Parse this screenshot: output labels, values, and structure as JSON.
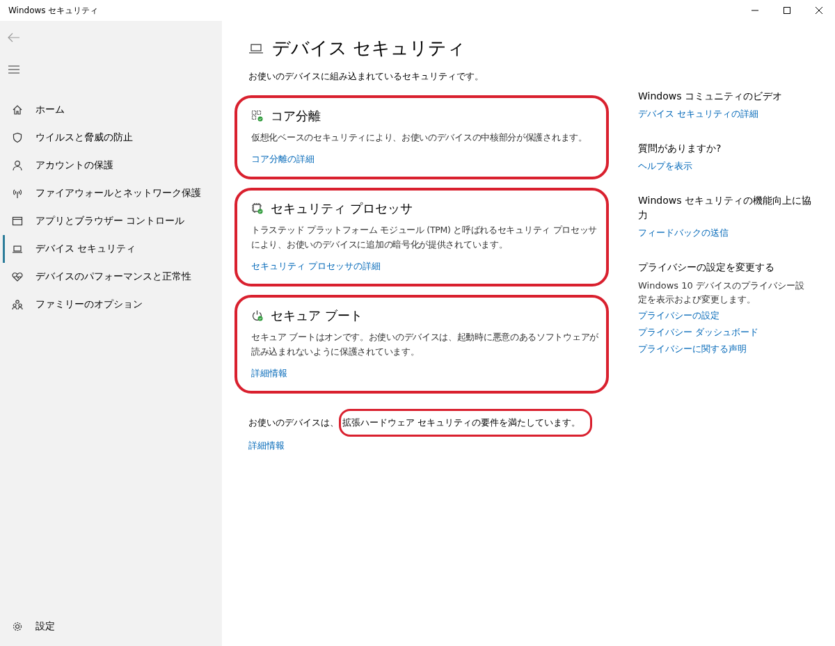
{
  "window": {
    "title": "Windows セキュリティ"
  },
  "sidebar": {
    "items": [
      {
        "label": "ホーム",
        "selected": false
      },
      {
        "label": "ウイルスと脅威の防止",
        "selected": false
      },
      {
        "label": "アカウントの保護",
        "selected": false
      },
      {
        "label": "ファイアウォールとネットワーク保護",
        "selected": false
      },
      {
        "label": "アプリとブラウザー コントロール",
        "selected": false
      },
      {
        "label": "デバイス セキュリティ",
        "selected": true
      },
      {
        "label": "デバイスのパフォーマンスと正常性",
        "selected": false
      },
      {
        "label": "ファミリーのオプション",
        "selected": false
      }
    ],
    "settings": "設定"
  },
  "page": {
    "title": "デバイス セキュリティ",
    "subtitle": "お使いのデバイスに組み込まれているセキュリティです。",
    "sections": [
      {
        "title": "コア分離",
        "text": "仮想化ベースのセキュリティにより、お使いのデバイスの中核部分が保護されます。",
        "link": "コア分離の詳細",
        "circled": true
      },
      {
        "title": "セキュリティ プロセッサ",
        "text": "トラステッド プラットフォーム モジュール (TPM) と呼ばれるセキュリティ プロセッサにより、お使いのデバイスに追加の暗号化が提供されています。",
        "link": "セキュリティ プロセッサの詳細",
        "circled": true
      },
      {
        "title": "セキュア ブート",
        "text": "セキュア ブートはオンです。お使いのデバイスは、起動時に悪意のあるソフトウェアが読み込まれないように保護されています。",
        "link": "詳細情報",
        "circled": true
      }
    ],
    "status": {
      "prefix": "お使いのデバイスは、",
      "circled_text": "拡張ハードウェア セキュリティの要件を満たしています。",
      "link": "詳細情報"
    }
  },
  "aside": [
    {
      "heading": "Windows コミュニティのビデオ",
      "links": [
        "デバイス セキュリティの詳細"
      ]
    },
    {
      "heading": "質問がありますか?",
      "links": [
        "ヘルプを表示"
      ]
    },
    {
      "heading": "Windows セキュリティの機能向上に協力",
      "links": [
        "フィードバックの送信"
      ]
    },
    {
      "heading": "プライバシーの設定を変更する",
      "text": "Windows 10 デバイスのプライバシー設定を表示および変更します。",
      "links": [
        "プライバシーの設定",
        "プライバシー ダッシュボード",
        "プライバシーに関する声明"
      ]
    }
  ]
}
